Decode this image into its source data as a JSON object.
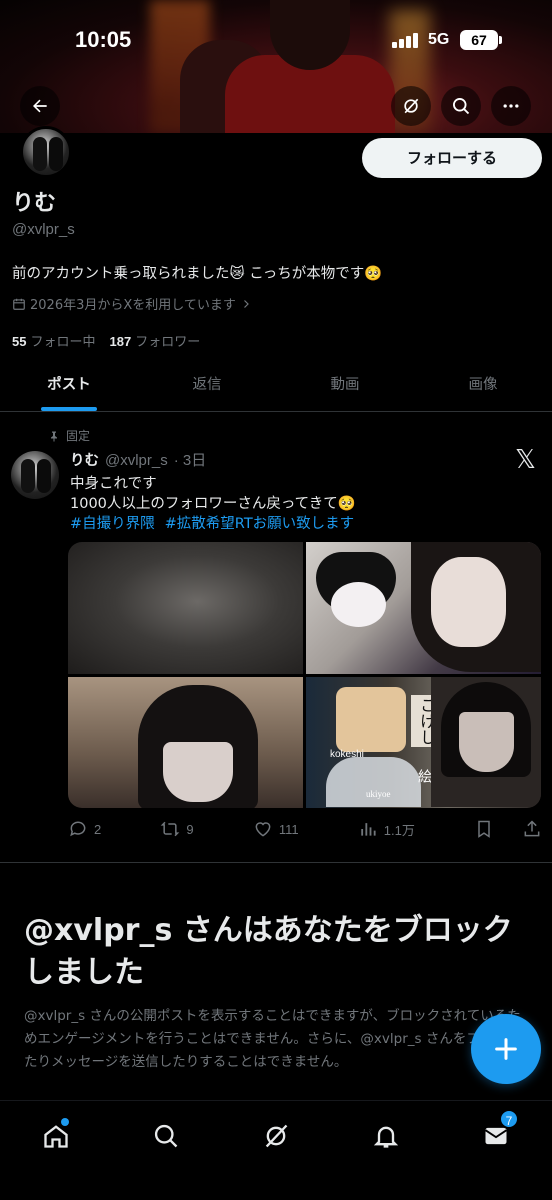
{
  "status_bar": {
    "time": "10:05",
    "network": "5G",
    "battery": "67"
  },
  "header": {
    "back_icon": "arrow-left-icon",
    "grok_icon": "grok-icon",
    "search_icon": "search-icon",
    "more_icon": "more-horizontal-icon"
  },
  "profile": {
    "follow_label": "フォローする",
    "name": "りむ",
    "handle": "@xvlpr_s",
    "bio": "前のアカウント乗っ取られました😿 こっちが本物です🥺",
    "joined": "2026年3月からXを利用しています",
    "following_count": "55",
    "following_label": "フォロー中",
    "followers_count": "187",
    "followers_label": "フォロワー"
  },
  "tabs": [
    {
      "label": "ポスト",
      "active": true
    },
    {
      "label": "返信",
      "active": false
    },
    {
      "label": "動画",
      "active": false
    },
    {
      "label": "画像",
      "active": false
    }
  ],
  "post": {
    "pinned_label": "固定",
    "name": "りむ",
    "handle": "@xvlpr_s",
    "time": "· 3日",
    "line1": "中身これです",
    "line2": "1000人以上のフォロワーさん戻ってきて🥺",
    "hashtag1": "#自撮り界隈",
    "hashtag2": "#拡散希望RTお願い致します",
    "media_text": {
      "kokeshi_jp": "こけし",
      "ukiyoe_jp": "浮世絵",
      "kokeshi_en": "kokeshi",
      "ukiyoe_en": "ukiyoe"
    },
    "replies": "2",
    "reposts": "9",
    "likes": "111",
    "views": "1.1万"
  },
  "blocked": {
    "title_handle": "@xvlpr_s",
    "title_rest": " さんはあなたをブロックしました",
    "description": "@xvlpr_s さんの公開ポストを表示することはできますが、ブロックされているためエンゲージメントを行うことはできません。さらに、@xvlpr_s さんをフォローしたりメッセージを送信したりすることはできません。"
  },
  "bottom_nav": {
    "messages_badge": "7"
  },
  "colors": {
    "accent": "#1d9bf0",
    "background": "#000000",
    "muted": "#71767b",
    "text": "#e7e9ea"
  }
}
